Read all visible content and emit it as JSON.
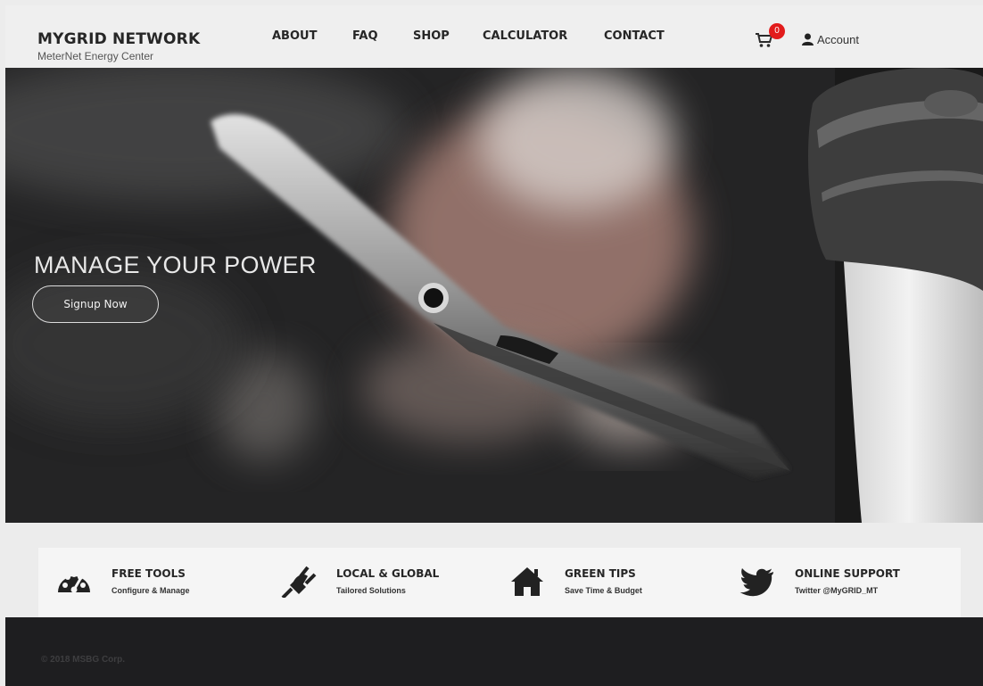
{
  "header": {
    "brand_title": "MYGRID NETWORK",
    "brand_subtitle": "MeterNet Energy Center",
    "nav": [
      {
        "label": "ABOUT"
      },
      {
        "label": "FAQ"
      },
      {
        "label": "SHOP"
      },
      {
        "label": "CALCULATOR"
      },
      {
        "label": "CONTACT"
      }
    ],
    "cart_count": "0",
    "account_label": "Account"
  },
  "hero": {
    "title": "MANAGE YOUR POWER",
    "cta_label": "Signup Now"
  },
  "features": [
    {
      "icon": "dashboard-icon",
      "title": "FREE TOOLS",
      "subtitle": "Configure & Manage"
    },
    {
      "icon": "plug-icon",
      "title": "LOCAL & GLOBAL",
      "subtitle": "Tailored Solutions"
    },
    {
      "icon": "home-icon",
      "title": "GREEN TIPS",
      "subtitle": "Save Time & Budget"
    },
    {
      "icon": "twitter-icon",
      "title": "ONLINE SUPPORT",
      "subtitle": "Twitter @MyGRID_MT"
    }
  ],
  "footer": {
    "copyright": "© 2018 MSBG Corp."
  },
  "colors": {
    "badge": "#e21b1b",
    "footer_bg": "#1e1e20",
    "header_bg": "#efefef"
  }
}
